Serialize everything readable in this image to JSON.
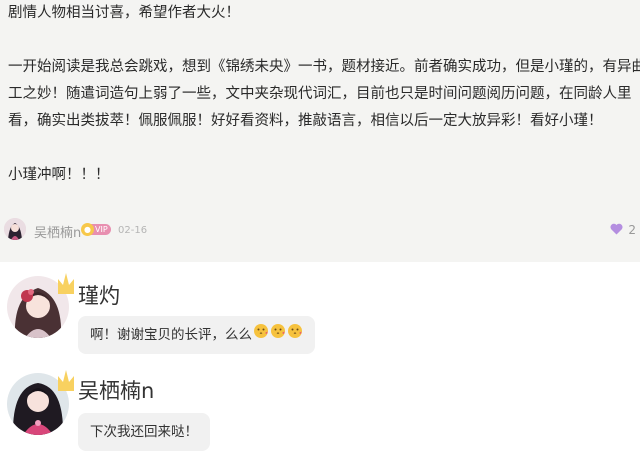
{
  "review": {
    "lines": [
      "剧情人物相当讨喜，希望作者大火！",
      "",
      "一开始阅读是我总会跳戏，想到《锦绣未央》一书，题材接近。前者确实成功，但是小瑾的，有异曲同",
      "工之妙！随遣词造句上弱了一些，文中夹杂现代词汇，目前也只是时间问题阅历问题，在同龄人里",
      "看，确实出类拔萃！佩服佩服！好好看资料，推敲语言，相信以后一定大放异彩！看好小瑾！",
      "",
      "小瑾冲啊！！！"
    ],
    "author": "吴栖楠n",
    "vip_label": "VIP",
    "date": "02-16",
    "likes": "2"
  },
  "replies": [
    {
      "name": "瑾灼",
      "text": "啊！谢谢宝贝的长评，么么",
      "emoji_count": 3
    },
    {
      "name": "吴栖楠n",
      "text": "下次我还回来哒！"
    }
  ],
  "colors": {
    "review_bg": "#f4f4f2",
    "bubble_bg": "#f1f1f1",
    "vip_pink": "#e88fb0",
    "like_purple": "#b48ee0",
    "crown_yellow": "#f8d160"
  },
  "icons": {
    "like": "heart-icon",
    "crown": "crown-icon",
    "emoji": "kiss-face-emoji-icon"
  }
}
